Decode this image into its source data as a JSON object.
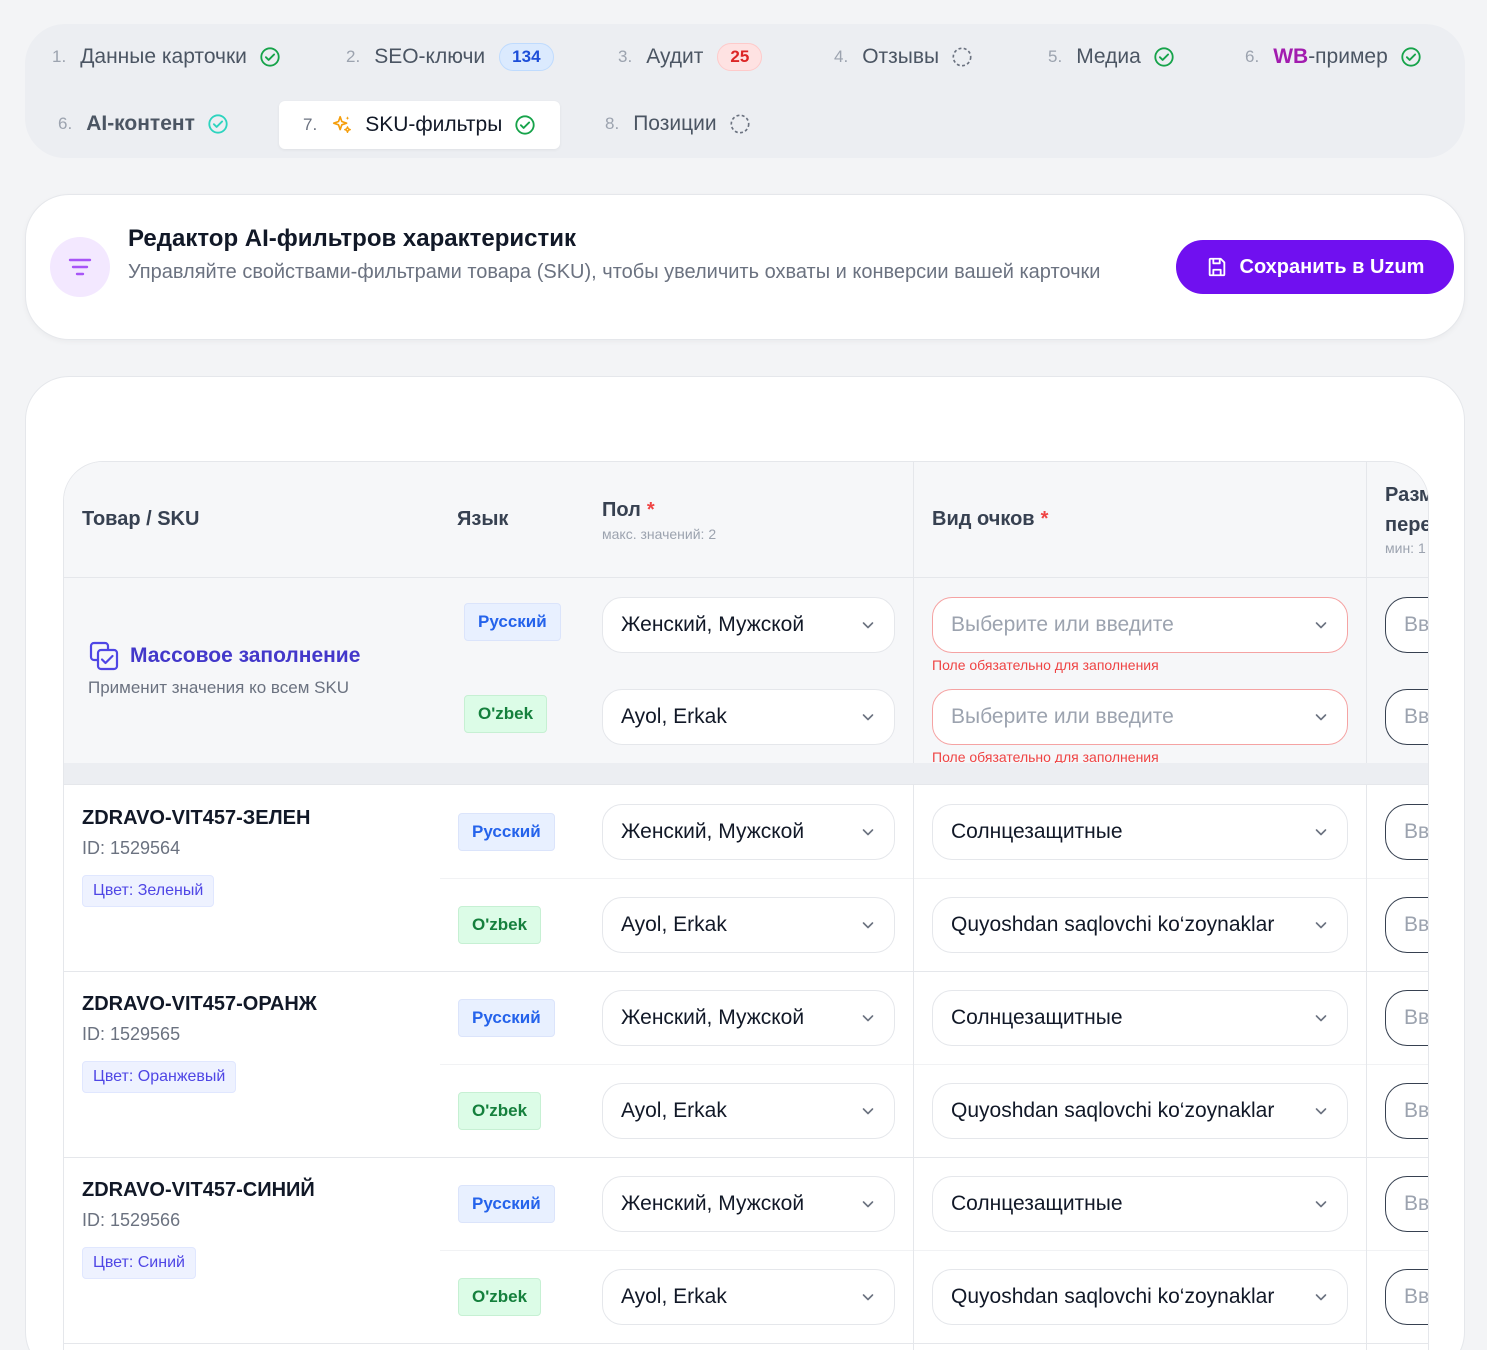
{
  "tabs": [
    {
      "num": "1.",
      "label": "Данные карточки",
      "status": "done"
    },
    {
      "num": "2.",
      "label": "SEO-ключи",
      "badge": "134",
      "badge_color": "blue"
    },
    {
      "num": "3.",
      "label": "Аудит",
      "badge": "25",
      "badge_color": "red"
    },
    {
      "num": "4.",
      "label": "Отзывы",
      "status": "pending"
    },
    {
      "num": "5.",
      "label": "Медиа",
      "status": "done"
    },
    {
      "num": "6.",
      "label_brand": "WB",
      "label_rest": "-пример",
      "status": "done"
    },
    {
      "num": "6.",
      "label": "AI-контент",
      "status": "done-teal"
    },
    {
      "num": "7.",
      "label": "SKU-фильтры",
      "status": "done",
      "active": true
    },
    {
      "num": "8.",
      "label": "Позиции",
      "status": "pending"
    }
  ],
  "header": {
    "title": "Редактор AI-фильтров характеристик",
    "subtitle": "Управляйте свойствами-фильтрами товара (SKU), чтобы увеличить охваты и конверсии вашей карточки",
    "save_label": "Сохранить в Uzum"
  },
  "table": {
    "col_product": "Товар / SKU",
    "col_lang": "Язык",
    "col_gender": "Пол",
    "col_gender_sub": "макс. значений: 2",
    "col_glasses": "Вид очков",
    "col_size_l1": "Разм",
    "col_size_l2": "пере",
    "col_size_sub": "мин: 1",
    "required_mark": "*"
  },
  "mass": {
    "title": "Массовое заполнение",
    "subtitle": "Применит значения ко всем SKU",
    "ru_lang": "Русский",
    "uz_lang": "O'zbek",
    "ru_gender": "Женский, Мужской",
    "uz_gender": "Ayol, Erkak",
    "placeholder": "Выберите или введите",
    "error": "Поле обязательно для заполнения",
    "partial": "Вв"
  },
  "skus": [
    {
      "name": "ZDRAVO-VIT457-ЗЕЛЕН",
      "id": "ID: 1529564",
      "color": "Цвет: Зеленый",
      "ru_lang": "Русский",
      "uz_lang": "O'zbek",
      "ru_gender": "Женский, Мужской",
      "uz_gender": "Ayol, Erkak",
      "ru_glasses": "Солнцезащитные",
      "uz_glasses": "Quyoshdan saqlovchi ko‘zoynaklar",
      "partial": "Вв"
    },
    {
      "name": "ZDRAVO-VIT457-ОРАНЖ",
      "id": "ID: 1529565",
      "color": "Цвет: Оранжевый",
      "ru_lang": "Русский",
      "uz_lang": "O'zbek",
      "ru_gender": "Женский, Мужской",
      "uz_gender": "Ayol, Erkak",
      "ru_glasses": "Солнцезащитные",
      "uz_glasses": "Quyoshdan saqlovchi ko‘zoynaklar",
      "partial": "Вв"
    },
    {
      "name": "ZDRAVO-VIT457-СИНИЙ",
      "id": "ID: 1529566",
      "color": "Цвет: Синий",
      "ru_lang": "Русский",
      "uz_lang": "O'zbek",
      "ru_gender": "Женский, Мужской",
      "uz_gender": "Ayol, Erkak",
      "ru_glasses": "Солнцезащитные",
      "uz_glasses": "Quyoshdan saqlovchi ko‘zoynaklar",
      "partial": "Вв"
    }
  ],
  "colors": {
    "accent": "#7010f0",
    "done": "#16a34a",
    "error": "#ef4444"
  }
}
